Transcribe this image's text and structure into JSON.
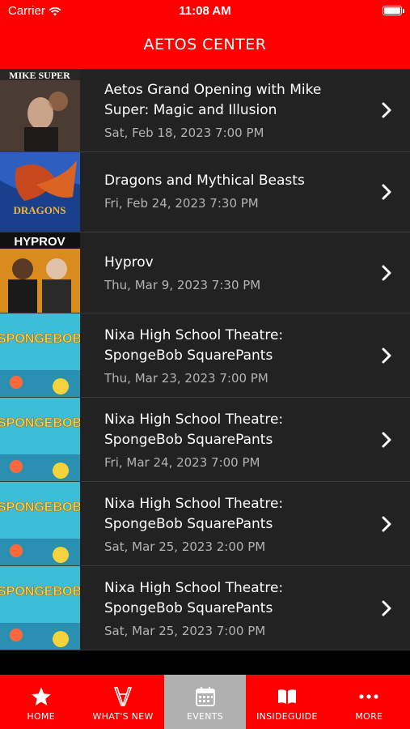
{
  "status_bar": {
    "carrier": "Carrier",
    "time": "11:08 AM"
  },
  "header": {
    "title": "AETOS CENTER"
  },
  "events": [
    {
      "title": "Aetos Grand Opening with Mike Super: Magic and Illusion",
      "date": "Sat, Feb 18, 2023 7:00 PM",
      "thumb_text": "MIKE SUPER"
    },
    {
      "title": "Dragons and Mythical Beasts",
      "date": "Fri, Feb 24, 2023 7:30 PM",
      "thumb_text": "DRAGONS"
    },
    {
      "title": "Hyprov",
      "date": "Thu, Mar 9, 2023 7:30 PM",
      "thumb_text": "HYPROV"
    },
    {
      "title": "Nixa High School Theatre: SpongeBob SquarePants",
      "date": "Thu, Mar 23, 2023 7:00 PM",
      "thumb_text": "SPONGEBOB"
    },
    {
      "title": "Nixa High School Theatre: SpongeBob SquarePants",
      "date": "Fri, Mar 24, 2023 7:00 PM",
      "thumb_text": "SPONGEBOB"
    },
    {
      "title": "Nixa High School Theatre: SpongeBob SquarePants",
      "date": "Sat, Mar 25, 2023 2:00 PM",
      "thumb_text": "SPONGEBOB"
    },
    {
      "title": "Nixa High School Theatre: SpongeBob SquarePants",
      "date": "Sat, Mar 25, 2023 7:00 PM",
      "thumb_text": "SPONGEBOB"
    }
  ],
  "tabs": [
    {
      "label": "HOME",
      "icon": "star-icon"
    },
    {
      "label": "WHAT'S NEW",
      "icon": "logo-icon"
    },
    {
      "label": "EVENTS",
      "icon": "calendar-icon",
      "active": true
    },
    {
      "label": "INSIDEGUIDE",
      "icon": "book-icon"
    },
    {
      "label": "MORE",
      "icon": "more-dots-icon"
    }
  ],
  "colors": {
    "brand": "#ff0000",
    "row_bg": "#222222",
    "active_tab": "#b0b0b0"
  }
}
